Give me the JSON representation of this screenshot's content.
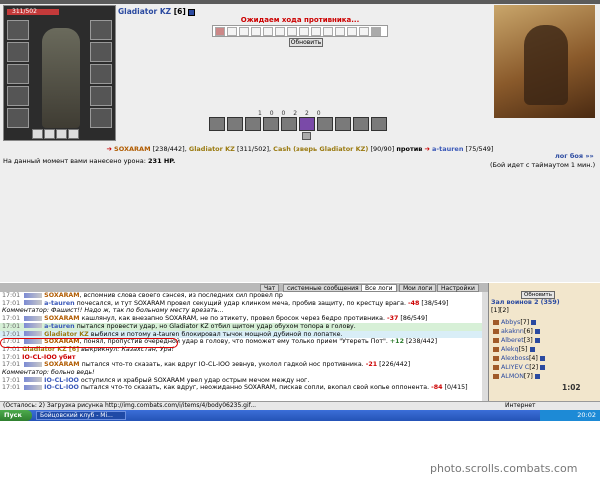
{
  "avatar": {
    "hp_text": "311/502"
  },
  "opponent": {
    "name": "Gladiator KZ",
    "level": "[6]"
  },
  "waiting_text": "Ожидаем хода противника...",
  "refresh_label": "Обновить",
  "counters": [
    "1",
    "0",
    "0",
    "2",
    "2",
    "0"
  ],
  "combat": {
    "a_name": "SOXARAM",
    "a_hp": "[238/442]",
    "b_name": "Gladiator KZ",
    "b_hp": "[311/502]",
    "c_name": "Cash (зверь Gladiator KZ)",
    "c_hp": "[90/90]",
    "vs": "против",
    "d_name": "a-tauren",
    "d_hp": "[75/549]"
  },
  "log_link": "лог боя »»",
  "damage": {
    "label": "На данный момент вами нанесено урона:",
    "value": "231 HP."
  },
  "timeout_text": "(Бой идет с таймаутом 1 мин.)",
  "chat_tabs": [
    "Чат",
    "системные сообщения",
    "Все логи",
    "Мои логи",
    "Настройки"
  ],
  "chat_lines": [
    {
      "time": "17:01",
      "name": "SOXARAM",
      "text": ", вспомнив слова своего сэнсея, из последних сил провел пр"
    },
    {
      "time": "17:01",
      "name": "a-tauren",
      "text": "почесался, и тут SOXARAM провел секущий удар клинком меча, пробив защиту, по крестцу врага.",
      "dmg": "-48",
      "hp": "[38/549]"
    },
    {
      "time": "",
      "name": "Комментатор:",
      "text": "Фашист!! Надо ж, так по больному месту врезать..."
    },
    {
      "time": "17:01",
      "name": "SOXARAM",
      "text": "кашлянул, как внезапно SOXARAM, не по этикету, провел бросок через бедро противника.",
      "dmg": "-37",
      "hp": "[86/549]"
    },
    {
      "time": "17:01",
      "name": "a-tauren",
      "text": "пытался провести удар, но Gladiator KZ отбил щитом удар обухом топора в голову."
    },
    {
      "time": "17:01",
      "name": "Gladiator KZ",
      "text": "выбился и потому a-tauren блокировал тычок мощной дубиной по лопатке."
    },
    {
      "time": "17:01",
      "name": "SOXARAM",
      "text": ", понял, пропустив очередной удар в голову, что поможет ему только прием \"Утереть Пот\".",
      "dmg": "+12",
      "hp": "[238/442]"
    },
    {
      "time": "17:01",
      "name": "Gladiator KZ [6]",
      "text": "выкрикнул: Казахстан, Ура!"
    },
    {
      "time": "17:01",
      "name": "IO-CL-IOO",
      "text": "убит"
    },
    {
      "time": "17:01",
      "name": "SOXARAM",
      "text": "пытался что-то сказать, как вдруг IO-CL-IOO зевнув, уколол гадкой нос противника.",
      "dmg": "-21",
      "hp": "[226/442]"
    },
    {
      "time": "",
      "name": "Комментатор:",
      "text": "больно ведь!"
    },
    {
      "time": "17:01",
      "name": "IO-CL-IOO",
      "text": "оступился и храбрый SOXARAM увел удар острым мечом между ног."
    },
    {
      "time": "17:01",
      "name": "IO-CL-IOO",
      "text": "пытался что-то сказать, как вдруг, неожиданно SOXARAM, пискав сопли, вкопал свой копье оппонента.",
      "dmg": "-84",
      "hp": "[0/415]"
    }
  ],
  "users": {
    "refresh": "Обновить",
    "header": "Зал воинов 2 (359)",
    "page": "[1][2]",
    "list": [
      {
        "name": "Abbys",
        "lvl": "[7]"
      },
      {
        "name": "akaknn",
        "lvl": "[6]"
      },
      {
        "name": "Alberet",
        "lvl": "[3]"
      },
      {
        "name": "Alekq",
        "lvl": "[5]"
      },
      {
        "name": "Alexboss",
        "lvl": "[4]"
      },
      {
        "name": "ALIYEV C",
        "lvl": "[2]"
      },
      {
        "name": "ALMON",
        "lvl": "[7]"
      }
    ]
  },
  "clock": "1:02",
  "status": {
    "text": "(Осталось: 2) Загрузка рисунка http://img.combats.com/i/items/4/body06235.gif...",
    "internet": "Интернет"
  },
  "taskbar": {
    "start": "Пуск",
    "item": "Бойцовский клуб - Mi...",
    "time": "20:02"
  },
  "watermark": "photo.scrolls.combats.com"
}
